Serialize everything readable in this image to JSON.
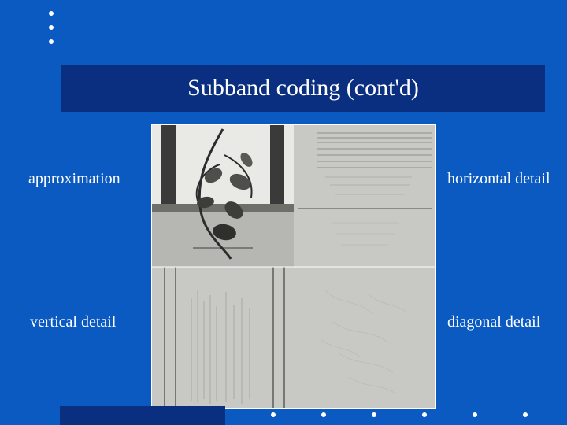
{
  "slide": {
    "title": "Subband coding (cont'd)",
    "labels": {
      "approximation": "approximation",
      "horizontal": "horizontal detail",
      "vertical": "vertical detail",
      "diagonal": "diagonal detail"
    },
    "quadrants": {
      "top_left": {
        "name": "approximation",
        "icon": "approximation-image"
      },
      "top_right": {
        "name": "horizontal-detail",
        "icon": "horizontal-detail-image"
      },
      "bottom_left": {
        "name": "vertical-detail",
        "icon": "vertical-detail-image"
      },
      "bottom_right": {
        "name": "diagonal-detail",
        "icon": "diagonal-detail-image"
      }
    },
    "colors": {
      "background": "#0b5ac2",
      "title_bar": "#0a2e80",
      "text": "#ffffff"
    }
  }
}
